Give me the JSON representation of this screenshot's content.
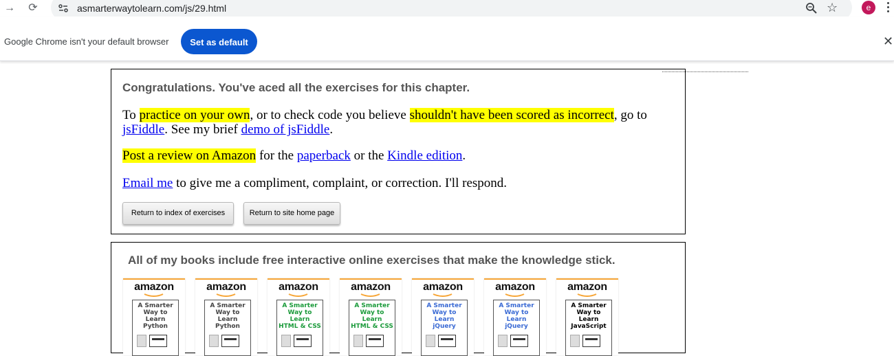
{
  "browser": {
    "url": "asmarterwaytolearn.com/js/29.html",
    "avatar_letter": "e",
    "infobar_text": "Google Chrome isn't your default browser",
    "set_default_label": "Set as default"
  },
  "chapter": {
    "congrats": "Congratulations. You've aced all the exercises for this chapter.",
    "p1": {
      "t1": "To ",
      "hl1": "practice on your own",
      "t2": ", or to check code you believe ",
      "hl2": "shouldn't have been scored as incorrect",
      "t3": ", go to ",
      "link1": "jsFiddle",
      "t4": ". See my brief ",
      "link2": "demo of jsFiddle",
      "t5": "."
    },
    "p2": {
      "hl": "Post a review on Amazon",
      "t1": " for the ",
      "link1": "paperback",
      "t2": " or the ",
      "link2": "Kindle edition",
      "t3": "."
    },
    "p3": {
      "link": "Email me",
      "t1": " to give me a compliment, complaint, or correction. I'll respond."
    },
    "buttons": {
      "index": "Return to index of exercises",
      "home": "Return to site home page"
    }
  },
  "books": {
    "title": "All of my books include free interactive online exercises that make the knowledge stick.",
    "brand": "amazon",
    "items": [
      {
        "line1": "A Smarter",
        "line2": "Way to",
        "line3": "Learn",
        "line4": "Python",
        "color": "#444444"
      },
      {
        "line1": "A Smarter",
        "line2": "Way to",
        "line3": "Learn",
        "line4": "Python",
        "color": "#444444"
      },
      {
        "line1": "A Smarter",
        "line2": "Way to",
        "line3": "Learn",
        "line4": "HTML & CSS",
        "color": "#1a9a3a"
      },
      {
        "line1": "A Smarter",
        "line2": "Way to",
        "line3": "Learn",
        "line4": "HTML & CSS",
        "color": "#1a9a3a"
      },
      {
        "line1": "A Smarter",
        "line2": "Way to",
        "line3": "Learn",
        "line4": "jQuery",
        "color": "#3a6ad4"
      },
      {
        "line1": "A Smarter",
        "line2": "Way to",
        "line3": "Learn",
        "line4": "jQuery",
        "color": "#3a6ad4"
      },
      {
        "line1": "A Smarter",
        "line2": "Way to",
        "line3": "Learn",
        "line4": "JavaScript",
        "color": "#000000"
      }
    ]
  }
}
